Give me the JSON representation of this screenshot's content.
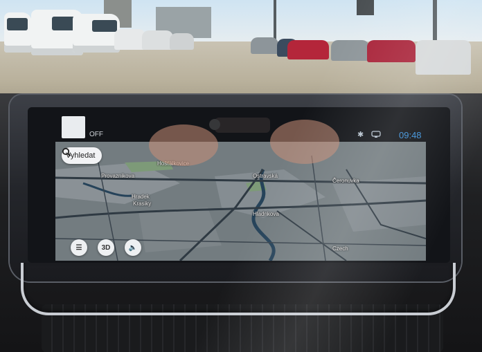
{
  "status_bar": {
    "app_label": "OFF",
    "icons": [
      "bluetooth-icon",
      "connected-device-icon"
    ],
    "time": "09:48"
  },
  "map": {
    "search_label": "Vyhledat",
    "controls": {
      "menu_icon": "menu-icon",
      "view_mode_label": "3D",
      "sound_icon": "volume-icon"
    },
    "place_labels": [
      "Hošťálkovice",
      "Provaznikova",
      "Ostravská",
      "Čeronuvka",
      "Hradek",
      "Hladnkova",
      "Krasiky",
      "Czech"
    ]
  },
  "colors": {
    "clock": "#3a8fd8",
    "map_base": "#6b7479",
    "road": "#2f3a43",
    "river": "#26435a"
  }
}
